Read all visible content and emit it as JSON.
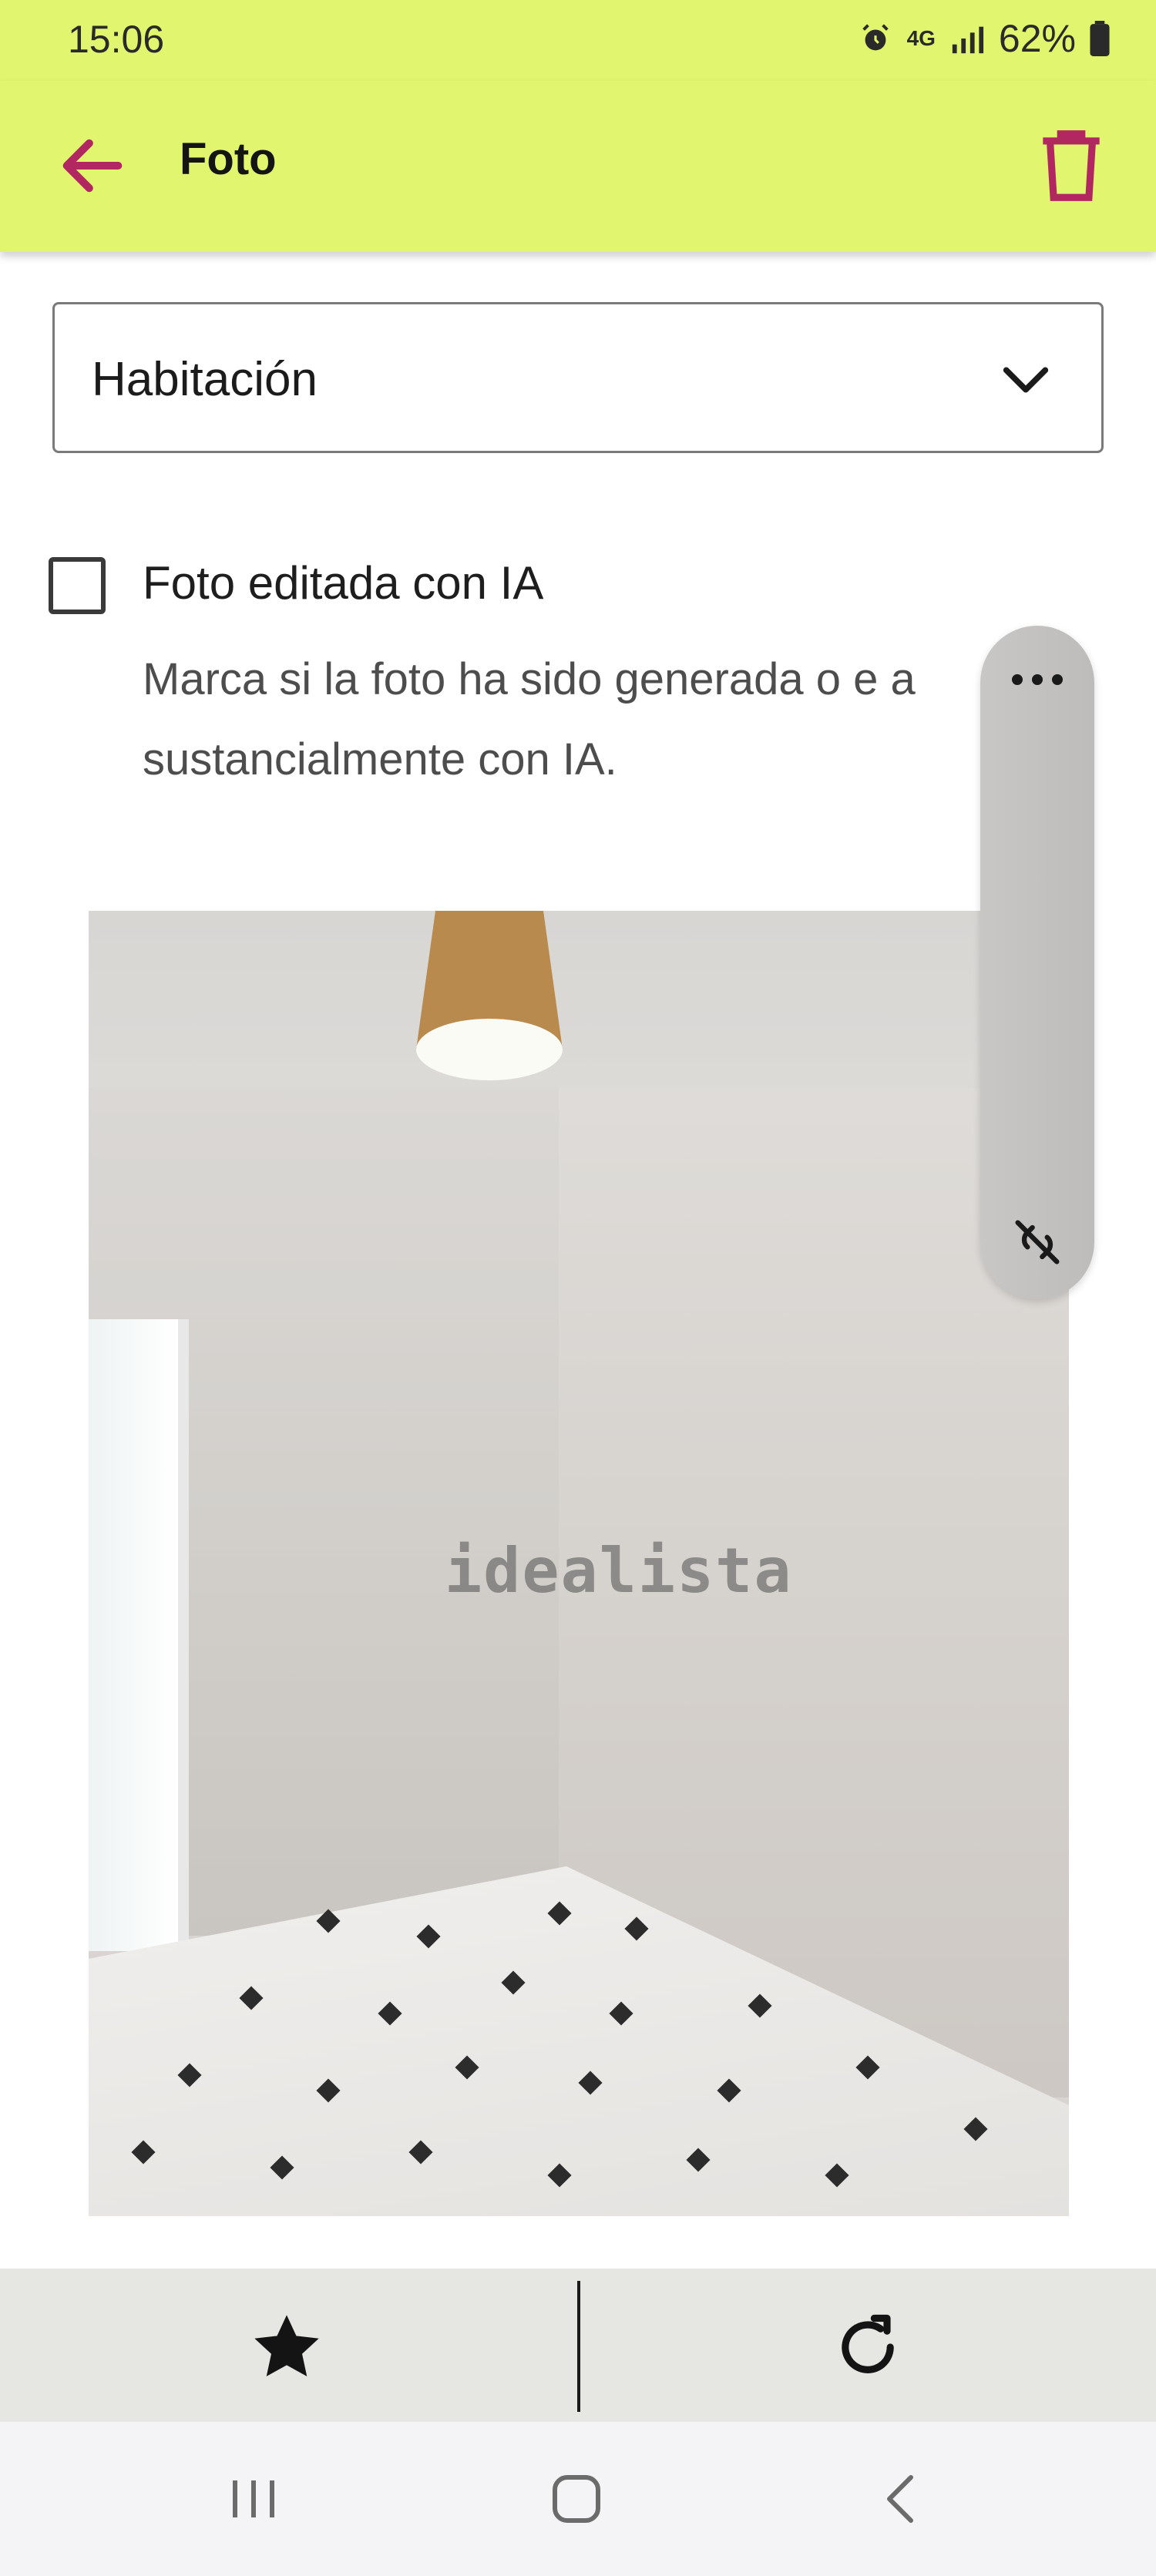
{
  "status_bar": {
    "time": "15:06",
    "network": "4G",
    "battery": "62%"
  },
  "app_bar": {
    "title": "Foto",
    "accent_color": "#b0285f",
    "background_color": "#e1f56f"
  },
  "room_select": {
    "value": "Habitación"
  },
  "ai_checkbox": {
    "checked": false,
    "label": "Foto editada con IA",
    "help_text_visible": "Marca si la foto ha sido generada o e          a sustancialmente con IA."
  },
  "photo": {
    "watermark": "idealista"
  },
  "floating_panel": {
    "icons": [
      "more-dots-icon",
      "link-off-icon"
    ]
  },
  "bottom_actions": {
    "icons": [
      "star-icon",
      "rotate-icon"
    ]
  },
  "nav_bar": {
    "icons": [
      "recent-apps-icon",
      "home-icon",
      "back-icon"
    ]
  }
}
